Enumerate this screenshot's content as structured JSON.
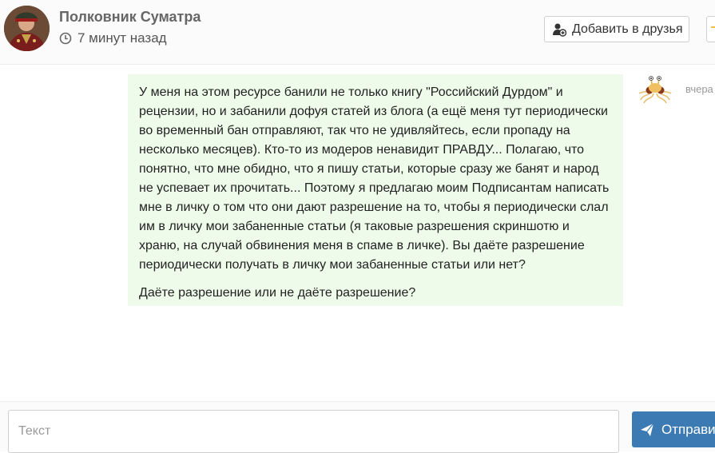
{
  "header": {
    "name": "Полковник Суматра",
    "last_seen": "7 минут назад",
    "add_friend_label": "Добавить в друзья"
  },
  "message": {
    "paragraphs": [
      "У меня на этом ресурсе банили не только книгу \"Российский Дурдом\" и рецензии, но и забанили дофуя статей из блога (а ещё меня тут периодически во временный бан отправляют, так что не удивляйтесь, если пропаду на несколько месяцев). Кто-то из модеров ненавидит ПРАВДУ... Полагаю, что понятно, что мне обидно, что я пишу статьи, которые сразу же банят и народ не успевает их прочитать... Поэтому я предлагаю моим Подписантам написать мне в личку о том что они дают разрешение на то, чтобы я периодически слал им в личку мои забаненные статьи (я таковые разрешения скриншотю и храню, на случай обвинения меня в спаме в личке). Вы даёте разрешение периодически получать в личку мои забаненные статьи или нет?",
      "Даёте разрешение или не даёте разрешение?"
    ],
    "time": "вчера"
  },
  "composer": {
    "placeholder": "Текст",
    "send_label": "Отправить"
  },
  "colors": {
    "bubble_bg": "#eefbea",
    "send_button": "#3c7ab4",
    "name_text": "#666666"
  },
  "icons": {
    "last_seen": "clock-icon",
    "add_friend": "add-user-icon",
    "send": "paper-plane-icon",
    "sender_avatar": "flying-spaghetti-monster-icon"
  }
}
